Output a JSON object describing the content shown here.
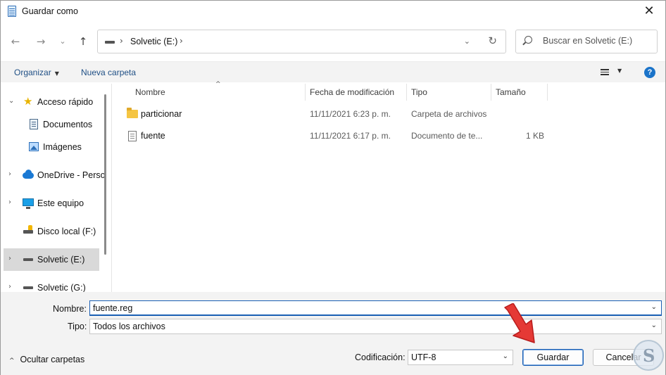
{
  "window": {
    "title": "Guardar como",
    "close_glyph": "✕"
  },
  "nav": {
    "back_glyph": "←",
    "forward_glyph": "→",
    "recent_glyph": "⌄",
    "up_glyph": "↑",
    "breadcrumb_sep": "›",
    "breadcrumb": "Solvetic (E:)",
    "dropdown_glyph": "⌄",
    "refresh_glyph": "↻",
    "search_placeholder": "Buscar en Solvetic (E:)"
  },
  "toolbar": {
    "organize_label": "Organizar",
    "new_folder_label": "Nueva carpeta",
    "caret_glyph": "▼",
    "help_glyph": "?"
  },
  "sidebar": {
    "expand_glyph": "›",
    "collapse_glyph": "⌄",
    "star_glyph": "★",
    "items": [
      {
        "label": "Acceso rápido",
        "icon": "star-icon",
        "expanded": true
      },
      {
        "label": "Documentos",
        "icon": "documents-icon"
      },
      {
        "label": "Imágenes",
        "icon": "pictures-icon"
      },
      {
        "label": "OneDrive - Perso",
        "icon": "cloud-icon"
      },
      {
        "label": "Este equipo",
        "icon": "computer-icon"
      },
      {
        "label": "Disco local (F:)",
        "icon": "drive-icon"
      },
      {
        "label": "Solvetic (E:)",
        "icon": "drive-icon",
        "selected": true
      },
      {
        "label": "Solvetic (G:)",
        "icon": "drive-icon"
      }
    ]
  },
  "filelist": {
    "columns": [
      "Nombre",
      "Fecha de modificación",
      "Tipo",
      "Tamaño"
    ],
    "sort_glyph": "^",
    "rows": [
      {
        "name": "particionar",
        "date": "11/11/2021 6:23 p. m.",
        "type": "Carpeta de archivos",
        "size": "",
        "icon": "folder-icon"
      },
      {
        "name": "fuente",
        "date": "11/11/2021 6:17 p. m.",
        "type": "Documento de te...",
        "size": "1 KB",
        "icon": "text-file-icon"
      }
    ]
  },
  "form": {
    "name_label": "Nombre:",
    "name_value": "fuente.reg",
    "type_label": "Tipo:",
    "type_value": "Todos los archivos",
    "dropdown_glyph": "⌄",
    "hide_folders_glyph": "^",
    "hide_folders_label": "Ocultar carpetas",
    "encoding_label": "Codificación:",
    "encoding_value": "UTF-8",
    "save_label": "Guardar",
    "cancel_label": "Cancelar"
  },
  "watermark": {
    "letter": "S"
  },
  "colors": {
    "accent": "#1a5fb4",
    "annotation_arrow": "#e53935",
    "folder": "#f5c542"
  }
}
